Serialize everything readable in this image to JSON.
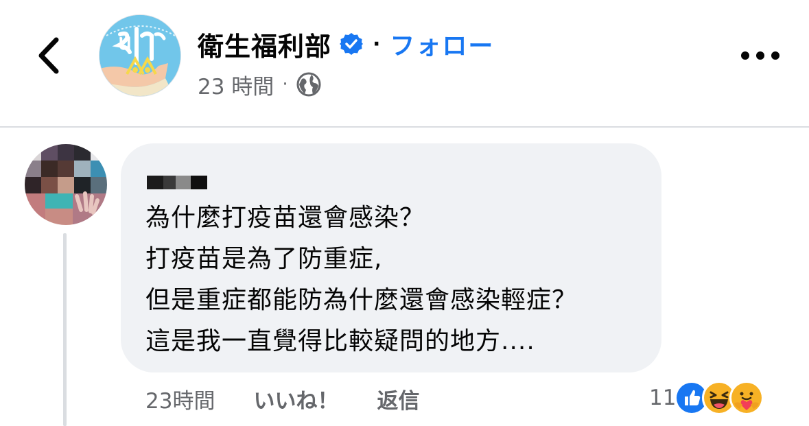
{
  "header": {
    "page_name": "衛生福利部",
    "separator": "·",
    "follow_label": "フォロー",
    "timestamp": "23 時間",
    "meta_separator": "·",
    "privacy_icon": "globe-icon",
    "back_icon": "chevron-left-icon",
    "more_icon": "more-horizontal-icon"
  },
  "comment": {
    "lines": [
      "為什麼打疫苗還會感染？",
      "打疫苗是為了防重症,",
      "但是重症都能防為什麼還會感染輕症？",
      "這是我一直覺得比較疑問的地方...."
    ],
    "time": "23時間",
    "like_label": "いいね！",
    "reply_label": "返信",
    "reaction_count": "11",
    "reactions": [
      "like-icon",
      "haha-icon",
      "care-icon"
    ]
  },
  "colors": {
    "accent": "#1877f2",
    "bubble": "#f0f2f5",
    "secondary_text": "#65676b",
    "divider": "#dadde1"
  }
}
